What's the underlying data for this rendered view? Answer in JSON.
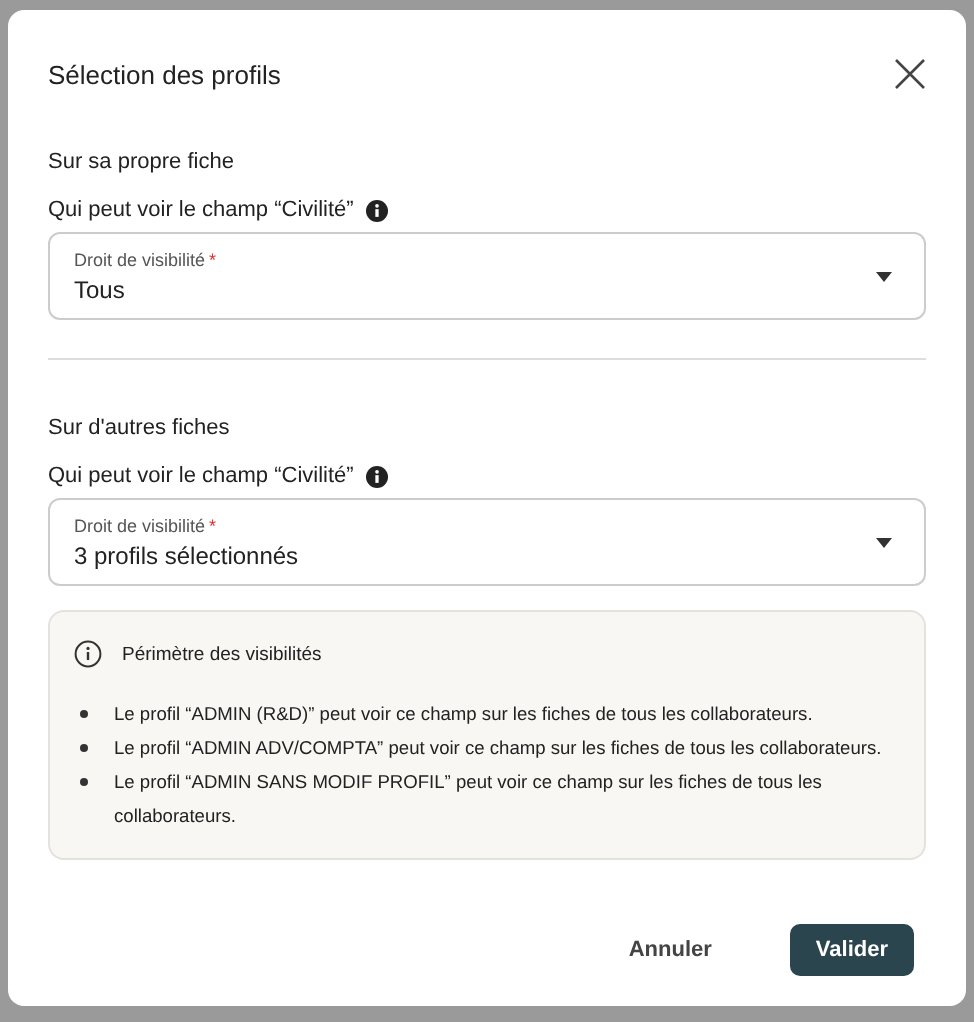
{
  "dialog": {
    "title": "Sélection des profils"
  },
  "sections": [
    {
      "heading": "Sur sa propre fiche",
      "question": "Qui peut voir le champ “Civilité”",
      "field": {
        "label": "Droit de visibilité",
        "required_mark": "*",
        "value": "Tous"
      }
    },
    {
      "heading": "Sur d'autres fiches",
      "question": "Qui peut voir le champ “Civilité”",
      "field": {
        "label": "Droit de visibilité",
        "required_mark": "*",
        "value": "3 profils sélectionnés"
      }
    }
  ],
  "info": {
    "title": "Périmètre des visibilités",
    "items": [
      "Le profil “ADMIN (R&D)” peut voir ce champ sur les fiches de tous les collaborateurs.",
      "Le profil “ADMIN ADV/COMPTA” peut voir ce champ sur les fiches de tous les collaborateurs.",
      "Le profil “ADMIN SANS MODIF PROFIL” peut voir ce champ sur les fiches de tous les collaborateurs."
    ]
  },
  "buttons": [
    {
      "label": "Annuler",
      "kind": "secondary"
    },
    {
      "label": "Valider",
      "kind": "primary"
    }
  ]
}
